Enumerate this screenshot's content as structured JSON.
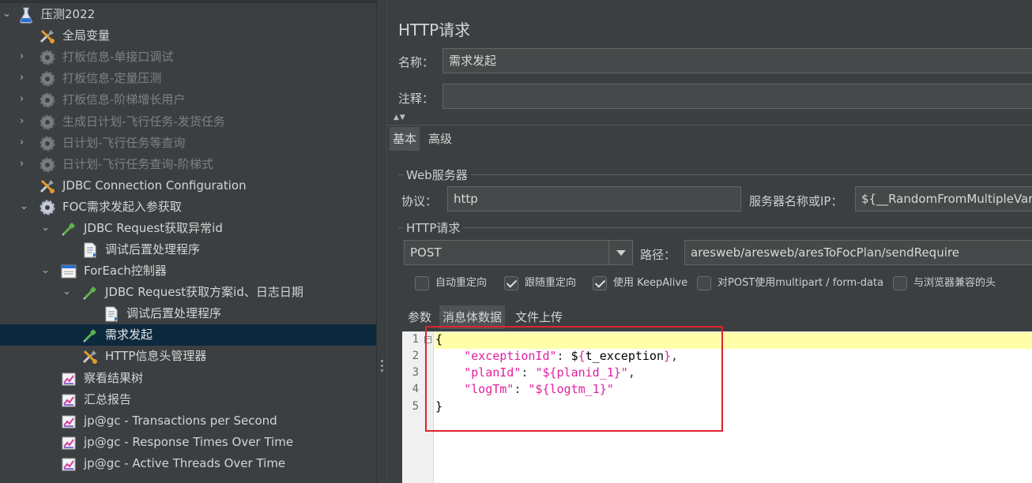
{
  "tree": {
    "items": [
      {
        "label": "压测2022",
        "icon": "flask-icon",
        "expanded": true,
        "disabled": false
      },
      {
        "label": "全局变量",
        "icon": "tools-icon",
        "disabled": false
      },
      {
        "label": "打板信息-单接口调试",
        "icon": "gear-icon",
        "disabled": true
      },
      {
        "label": "打板信息-定量压测",
        "icon": "gear-icon",
        "disabled": true
      },
      {
        "label": "打板信息-阶梯增长用户",
        "icon": "gear-icon",
        "disabled": true
      },
      {
        "label": "生成日计划-飞行任务-发货任务",
        "icon": "gear-icon",
        "disabled": true
      },
      {
        "label": "日计划-飞行任务等查询",
        "icon": "gear-icon",
        "disabled": true
      },
      {
        "label": "日计划-飞行任务查询-阶梯式",
        "icon": "gear-icon",
        "disabled": true
      },
      {
        "label": "JDBC Connection Configuration",
        "icon": "tools-icon",
        "disabled": false
      },
      {
        "label": "FOC需求发起入参获取",
        "icon": "gear-icon",
        "disabled": false
      },
      {
        "label": "JDBC Request获取异常id",
        "icon": "pipette-icon",
        "disabled": false
      },
      {
        "label": "调试后置处理程序",
        "icon": "document-icon",
        "disabled": false
      },
      {
        "label": "ForEach控制器",
        "icon": "foreach-icon",
        "disabled": false
      },
      {
        "label": "JDBC Request获取方案id、日志日期",
        "icon": "pipette-icon",
        "disabled": false
      },
      {
        "label": "调试后置处理程序",
        "icon": "document-icon",
        "disabled": false
      },
      {
        "label": "需求发起",
        "icon": "pipette-icon",
        "disabled": false,
        "selected": true
      },
      {
        "label": "HTTP信息头管理器",
        "icon": "tools-icon",
        "disabled": false
      },
      {
        "label": "察看结果树",
        "icon": "graph-icon",
        "disabled": false
      },
      {
        "label": "汇总报告",
        "icon": "graph-icon",
        "disabled": false
      },
      {
        "label": "jp@gc - Transactions per Second",
        "icon": "graph-icon",
        "disabled": false
      },
      {
        "label": "jp@gc - Response Times Over Time",
        "icon": "graph-icon",
        "disabled": false
      },
      {
        "label": "jp@gc - Active Threads Over Time",
        "icon": "graph-icon",
        "disabled": false
      }
    ]
  },
  "panel": {
    "title": "HTTP请求",
    "name_label": "名称：",
    "name_value": "需求发起",
    "comment_label": "注释：",
    "comment_value": "",
    "tabs": [
      "基本",
      "高级"
    ],
    "web_server": {
      "section_title": "Web服务器",
      "protocol_label": "协议：",
      "protocol_value": "http",
      "server_label": "服务器名称或IP：",
      "server_value": "${__RandomFromMultipleVars("
    },
    "http_request": {
      "section_title": "HTTP请求",
      "method": "POST",
      "path_label": "路径：",
      "path_value": "aresweb/aresweb/aresToFocPlan/sendRequire"
    },
    "checkboxes": [
      {
        "label": "自动重定向",
        "checked": false
      },
      {
        "label": "跟随重定向",
        "checked": true
      },
      {
        "label": "使用 KeepAlive",
        "checked": true
      },
      {
        "label": "对POST使用multipart / form-data",
        "checked": false
      },
      {
        "label": "与浏览器兼容的头",
        "checked": false
      }
    ],
    "body_tabs": [
      "参数",
      "消息体数据",
      "文件上传"
    ],
    "editor": {
      "line_numbers": [
        "1",
        "2",
        "3",
        "4",
        "5"
      ],
      "lines": {
        "l1": "{",
        "l2_key": "\"exceptionId\"",
        "l2_colon": ": ",
        "l2_val_pre": "$",
        "l2_val_open": "{",
        "l2_val_name": "t_exception",
        "l2_val_close": "}",
        "l2_comma": ",",
        "l3_key": "\"planId\"",
        "l3_colon": ": ",
        "l3_val": "\"${planid_1}\"",
        "l3_comma": ",",
        "l4_key": "\"logTm\"",
        "l4_colon": ": ",
        "l4_val": "\"${logtm_1}\"",
        "l5": "}"
      }
    }
  },
  "colors": {
    "background": "#3c3f41",
    "selection": "#0d293e",
    "json_key": "#e020a0",
    "highlight_line": "#ffffaa",
    "annotation_box": "#e0242e"
  }
}
